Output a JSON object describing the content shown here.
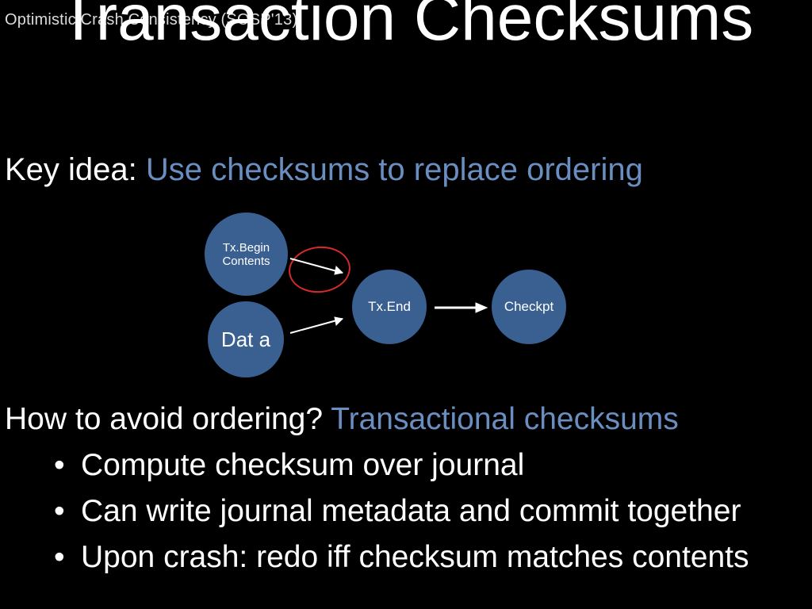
{
  "header": {
    "note": "Optimistic Crash Consistency (SOSP'13)"
  },
  "title": "Transaction Checksums",
  "keyidea": {
    "prefix": "Key idea: ",
    "highlight": "Use checksums to replace ordering"
  },
  "diagram": {
    "txbegin": "Tx.Begin Contents",
    "data": "Dat a",
    "txend": "Tx.End",
    "checkpt": "Checkpt"
  },
  "howto": {
    "question": "How to avoid ordering? ",
    "highlight": "Transactional checksums",
    "bullets": [
      "Compute checksum over journal",
      "Can write journal metadata and commit together",
      "Upon crash: redo iff checksum matches contents"
    ]
  }
}
